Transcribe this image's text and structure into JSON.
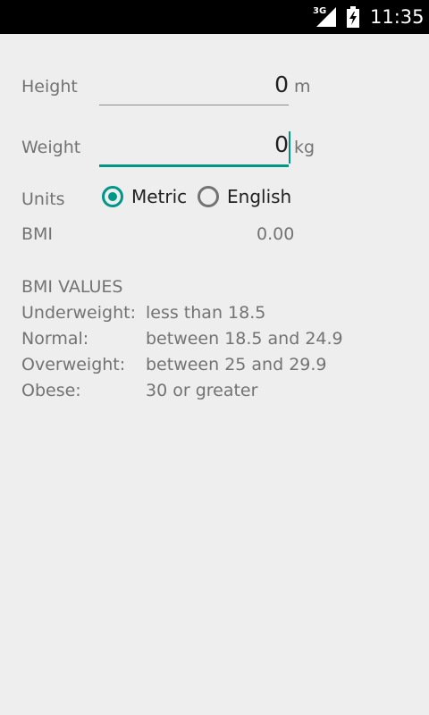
{
  "status_bar": {
    "network_type": "3G",
    "time": "11:35"
  },
  "form": {
    "height": {
      "label": "Height",
      "value": "0",
      "unit": "m"
    },
    "weight": {
      "label": "Weight",
      "value": "0",
      "unit": "kg"
    },
    "units": {
      "label": "Units",
      "options": [
        "Metric",
        "English"
      ],
      "selected": "Metric"
    },
    "bmi": {
      "label": "BMI",
      "value": "0.00"
    }
  },
  "colors": {
    "accent": "#009688",
    "status_bar": "#000000",
    "background": "#eeeeee"
  },
  "bmi_values": {
    "title": "BMI VALUES",
    "rows": [
      {
        "category": "Underweight:",
        "range": "less than 18.5"
      },
      {
        "category": "Normal:",
        "range": "between 18.5 and 24.9"
      },
      {
        "category": "Overweight:",
        "range": "between 25 and 29.9"
      },
      {
        "category": "Obese:",
        "range": "30 or greater"
      }
    ]
  }
}
